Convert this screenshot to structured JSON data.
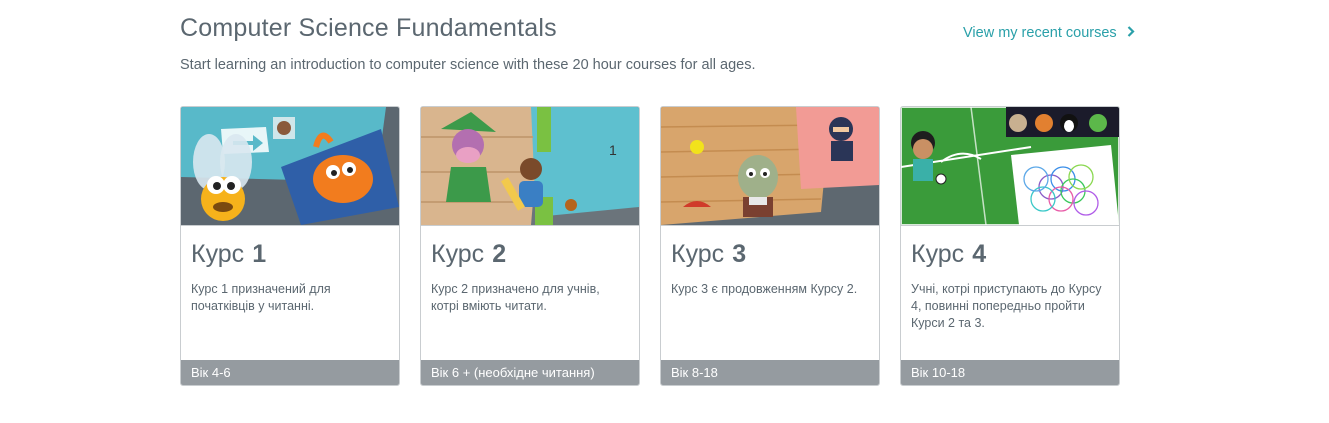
{
  "header": {
    "title": "Computer Science Fundamentals",
    "subtitle": "Start learning an introduction to computer science with these 20 hour courses for all ages.",
    "recent_link": "View my recent courses"
  },
  "cards": [
    {
      "course_word": "Курс",
      "number": "1",
      "description": "Курс 1 призначений для початківців у читанні.",
      "age": "Вік 4-6"
    },
    {
      "course_word": "Курс",
      "number": "2",
      "description": "Курс 2 призначено для учнів, котрі вміють читати.",
      "age": "Вік 6 + (необхідне читання)"
    },
    {
      "course_word": "Курс",
      "number": "3",
      "description": "Курс 3 є продовженням Курсу 2.",
      "age": "Вік 8-18"
    },
    {
      "course_word": "Курс",
      "number": "4",
      "description": "Учні, котрі приступають до Курсу 4, повинні попередньо пройти Курси 2 та 3.",
      "age": "Вік 10-18"
    }
  ],
  "colors": {
    "accent": "#2aa0a9",
    "text": "#5b6770",
    "age_bar": "#959ba0"
  },
  "icons": {
    "recent_link": "chevron-right-icon"
  }
}
